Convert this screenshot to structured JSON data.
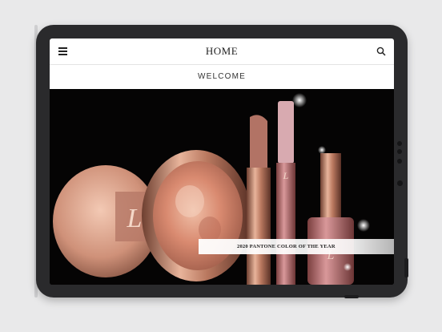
{
  "header": {
    "title": "HOME",
    "menu_icon": "hamburger-menu-icon",
    "search_icon": "search-icon"
  },
  "subheader": {
    "title": "WELCOME"
  },
  "hero": {
    "banner_text": "2020 PANTONE COLOR OF THE YEAR"
  },
  "colors": {
    "page_background": "#e9e9ea",
    "device_frame": "#2a2a2c",
    "hero_background": "#050404",
    "rose_gold": "#d9a08a"
  }
}
